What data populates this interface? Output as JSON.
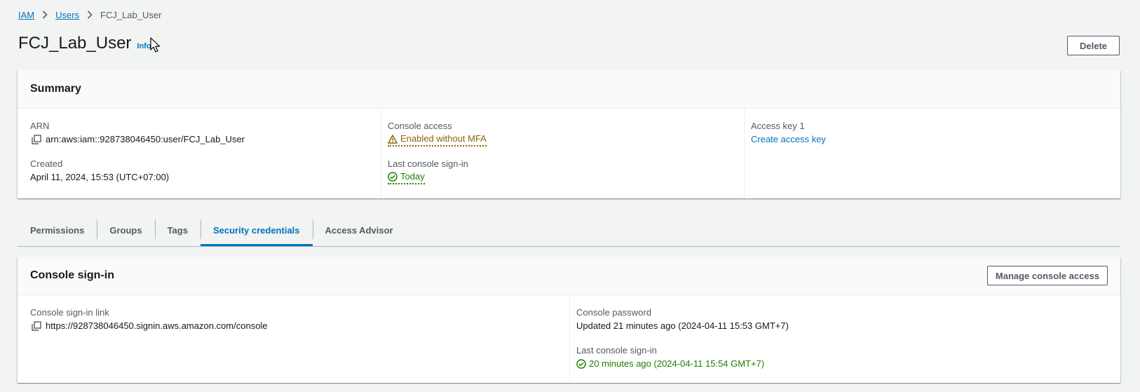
{
  "breadcrumb": {
    "items": [
      "IAM",
      "Users"
    ],
    "current": "FCJ_Lab_User"
  },
  "page": {
    "title": "FCJ_Lab_User",
    "info_label": "Info",
    "delete_label": "Delete"
  },
  "summary": {
    "title": "Summary",
    "arn_label": "ARN",
    "arn_value": "arn:aws:iam::928738046450:user/FCJ_Lab_User",
    "created_label": "Created",
    "created_value": "April 11, 2024, 15:53 (UTC+07:00)",
    "console_access_label": "Console access",
    "console_access_value": "Enabled without MFA",
    "last_signin_label": "Last console sign-in",
    "last_signin_value": "Today",
    "access_key_label": "Access key 1",
    "access_key_link": "Create access key"
  },
  "tabs": [
    {
      "label": "Permissions"
    },
    {
      "label": "Groups"
    },
    {
      "label": "Tags"
    },
    {
      "label": "Security credentials"
    },
    {
      "label": "Access Advisor"
    }
  ],
  "active_tab": "Security credentials",
  "console_signin": {
    "title": "Console sign-in",
    "manage_label": "Manage console access",
    "link_label": "Console sign-in link",
    "link_value": "https://928738046450.signin.aws.amazon.com/console",
    "password_label": "Console password",
    "password_value": "Updated 21 minutes ago (2024-04-11 15:53 GMT+7)",
    "last_signin_label": "Last console sign-in",
    "last_signin_value": "20 minutes ago (2024-04-11 15:54 GMT+7)"
  },
  "colors": {
    "link": "#0073bb",
    "warning": "#8d6605",
    "success": "#1d8102",
    "background": "#f2f3f3"
  }
}
